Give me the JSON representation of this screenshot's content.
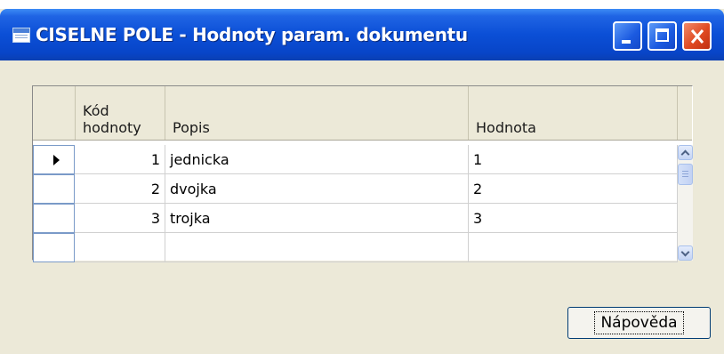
{
  "window": {
    "title": "CISELNE POLE - Hodnoty param. dokumentu",
    "icon": "table-icon",
    "controls": [
      "minimize-icon",
      "maximize-icon",
      "close-icon"
    ]
  },
  "grid": {
    "columns": [
      {
        "key": "kod",
        "label": "Kód\nhodnoty"
      },
      {
        "key": "popis",
        "label": "Popis"
      },
      {
        "key": "hodnota",
        "label": "Hodnota"
      }
    ],
    "rows": [
      {
        "kod": "1",
        "popis": "jednicka",
        "hodnota": "1",
        "current": true
      },
      {
        "kod": "2",
        "popis": "dvojka",
        "hodnota": "2",
        "current": false
      },
      {
        "kod": "3",
        "popis": "trojka",
        "hodnota": "3",
        "current": false
      },
      {
        "kod": "",
        "popis": "",
        "hodnota": "",
        "current": false
      }
    ],
    "scrollbar": [
      "scroll-up-icon",
      "scroll-thumb",
      "scroll-down-icon"
    ]
  },
  "buttons": {
    "help_label": "Nápověda"
  },
  "colors": {
    "titlebar": "#0b4fd6",
    "window_bg": "#ece9d8",
    "close_button": "#e04a22"
  }
}
